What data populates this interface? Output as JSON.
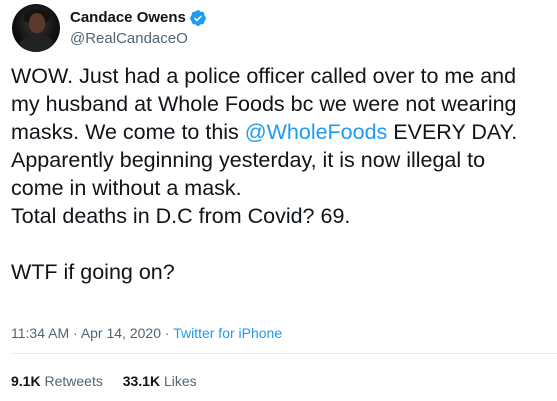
{
  "user": {
    "display_name": "Candace Owens",
    "handle": "@RealCandaceO",
    "verified": true,
    "avatar_icon": "profile-photo"
  },
  "tweet": {
    "lines": [
      "WOW. Just had a police officer called over to me and",
      "my husband at Whole Foods bc we were not wearing",
      "masks. We come to this ",
      "Apparently beginning yesterday, it is now illegal to",
      "come in without a mask.",
      "Total deaths in D.C from Covid? 69.",
      "",
      "WTF if going on?"
    ],
    "mention": "@WholeFoods",
    "mention_suffix": " EVERY DAY."
  },
  "meta": {
    "time": "11:34 AM",
    "separator": "·",
    "date": "Apr 14, 2020",
    "source": "Twitter for iPhone"
  },
  "stats": {
    "retweets_count": "9.1K",
    "retweets_label": "Retweets",
    "likes_count": "33.1K",
    "likes_label": "Likes"
  },
  "colors": {
    "link": "#1d9bf0",
    "text": "#0f1419",
    "secondary": "#536471",
    "verified": "#1d9bf0"
  }
}
